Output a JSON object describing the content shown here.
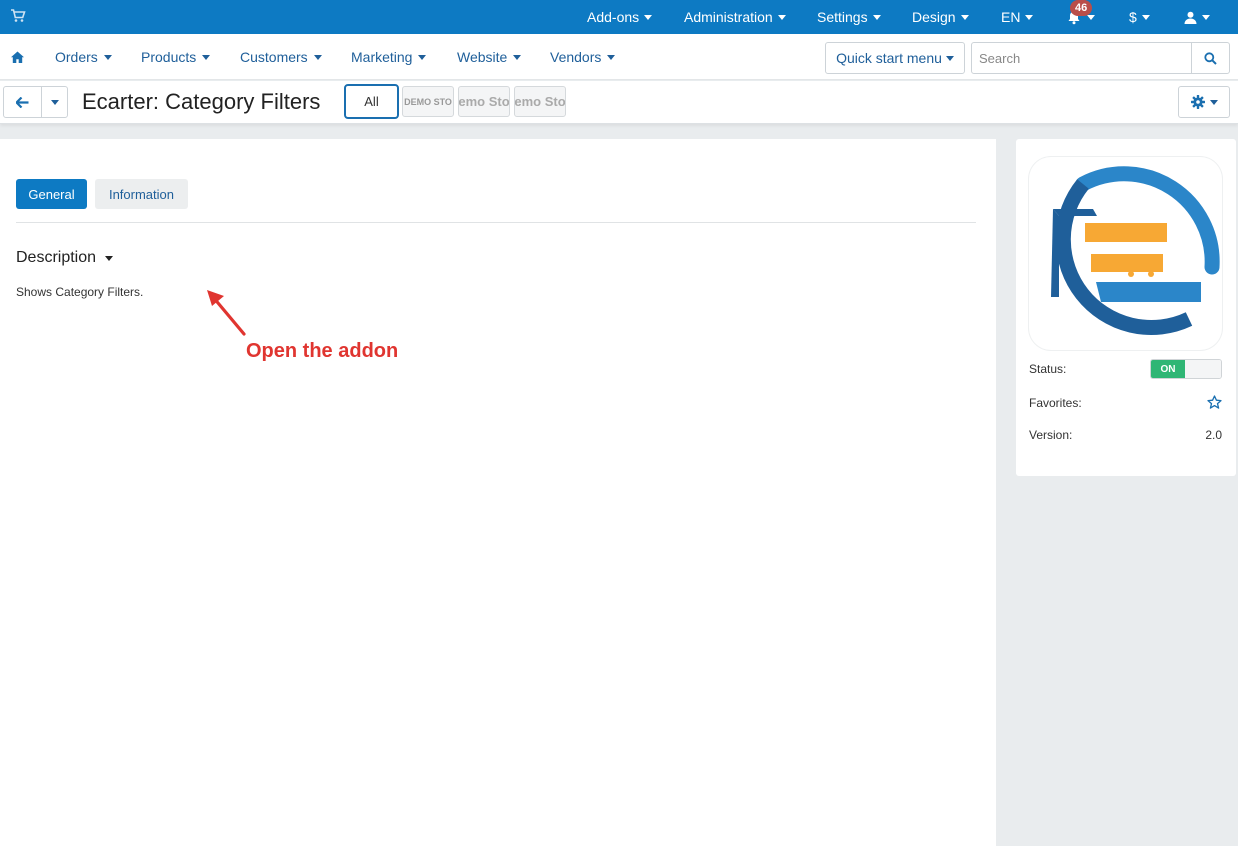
{
  "topbar": {
    "menu": [
      {
        "label": "Add-ons"
      },
      {
        "label": "Administration"
      },
      {
        "label": "Settings"
      },
      {
        "label": "Design"
      },
      {
        "label": "EN"
      }
    ],
    "notifications_count": "46",
    "currency": "$"
  },
  "nav": {
    "items": [
      {
        "label": "Orders"
      },
      {
        "label": "Products"
      },
      {
        "label": "Customers"
      },
      {
        "label": "Marketing"
      },
      {
        "label": "Website"
      },
      {
        "label": "Vendors"
      }
    ],
    "quick_start_label": "Quick start menu",
    "search_placeholder": "Search"
  },
  "titlebar": {
    "title": "Ecarter: Category Filters",
    "store_all_label": "All",
    "store_thumbs": [
      "DEMO STO",
      "emo Sto",
      "emo Sto"
    ]
  },
  "tabs": [
    {
      "label": "General",
      "active": true
    },
    {
      "label": "Information",
      "active": false
    }
  ],
  "description": {
    "heading": "Description",
    "text": "Shows Category Filters."
  },
  "annotation": {
    "text": "Open the addon",
    "color": "#e03530"
  },
  "sidebar": {
    "status_label": "Status:",
    "status_value": "ON",
    "favorites_label": "Favorites:",
    "version_label": "Version:",
    "version_value": "2.0"
  },
  "colors": {
    "primary": "#0d7ac3",
    "toggle_on": "#2fb675",
    "logo_orange": "#f7a834"
  }
}
